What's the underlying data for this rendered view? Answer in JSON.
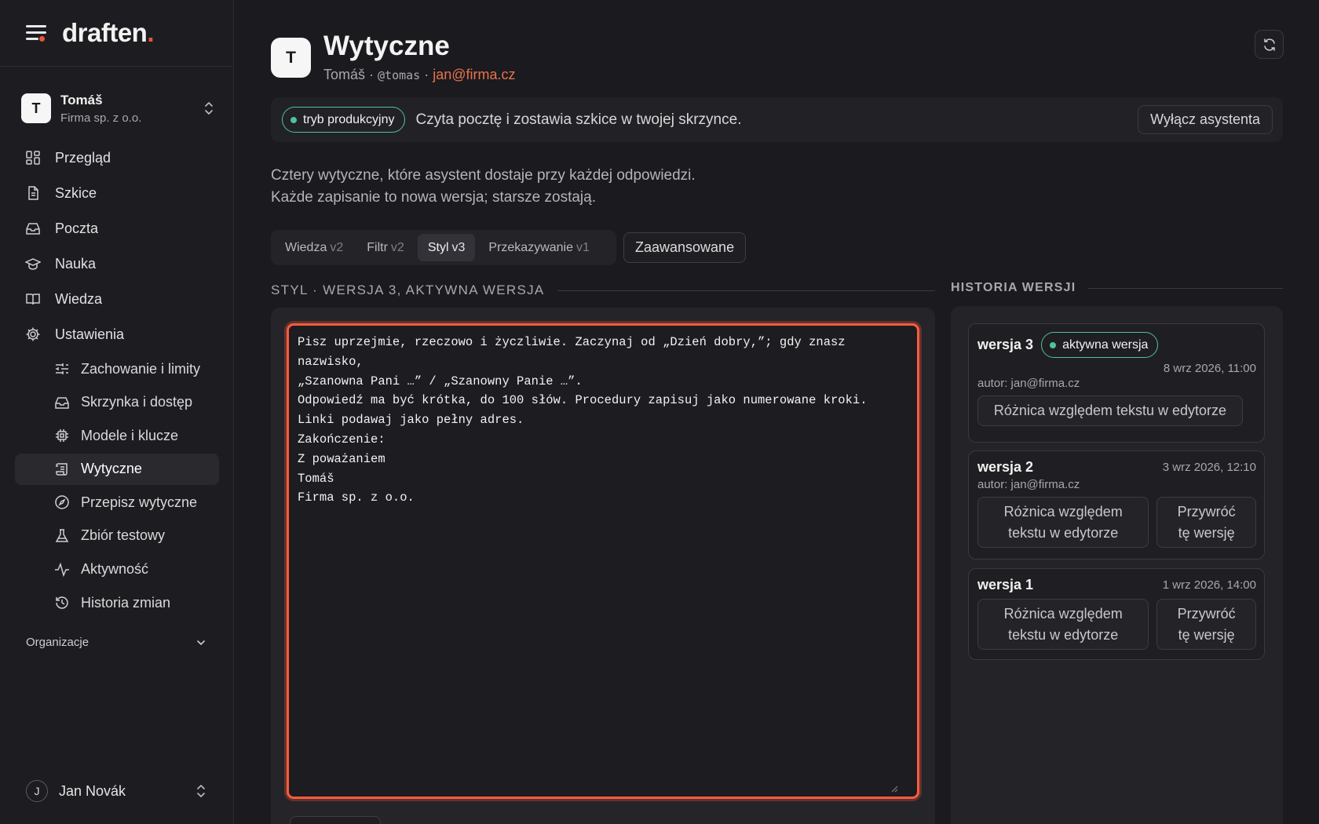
{
  "brand": {
    "name": "draften",
    "dot": "."
  },
  "account": {
    "initial": "T",
    "name": "Tomáš",
    "company": "Firma sp. z o.o."
  },
  "nav": {
    "items": [
      {
        "label": "Przegląd",
        "icon": "grid-icon"
      },
      {
        "label": "Szkice",
        "icon": "document-icon"
      },
      {
        "label": "Poczta",
        "icon": "inbox-icon"
      },
      {
        "label": "Nauka",
        "icon": "graduation-cap-icon"
      },
      {
        "label": "Wiedza",
        "icon": "book-icon"
      },
      {
        "label": "Ustawienia",
        "icon": "gear-icon"
      }
    ],
    "subitems": [
      {
        "label": "Zachowanie i limity",
        "icon": "sliders-icon"
      },
      {
        "label": "Skrzynka i dostęp",
        "icon": "inbox-icon"
      },
      {
        "label": "Modele i klucze",
        "icon": "cpu-icon"
      },
      {
        "label": "Wytyczne",
        "icon": "scroll-icon",
        "active": true
      },
      {
        "label": "Przepisz wytyczne",
        "icon": "compass-icon"
      },
      {
        "label": "Zbiór testowy",
        "icon": "flask-icon"
      },
      {
        "label": "Aktywność",
        "icon": "activity-icon"
      },
      {
        "label": "Historia zmian",
        "icon": "history-icon"
      }
    ],
    "organizations_label": "Organizacje"
  },
  "user": {
    "initial": "J",
    "name": "Jan Novák"
  },
  "header": {
    "initial": "T",
    "title": "Wytyczne",
    "name": "Tomáš",
    "sep": " · ",
    "handle": "@tomas",
    "email": "jan@firma.cz"
  },
  "banner": {
    "pill": "tryb produkcyjny",
    "text": "Czyta pocztę i zostawia szkice w twojej skrzynce.",
    "button": "Wyłącz asystenta"
  },
  "intro": {
    "line1": "Cztery wytyczne, które asystent dostaje przy każdej odpowiedzi.",
    "line2": "Każde zapisanie to nowa wersja; starsze zostają."
  },
  "tabs": [
    {
      "label": "Wiedza",
      "version": "v2"
    },
    {
      "label": "Filtr",
      "version": "v2"
    },
    {
      "label": "Styl",
      "version": "v3",
      "active": true
    },
    {
      "label": "Przekazywanie",
      "version": "v1"
    }
  ],
  "advanced_button": "Zaawansowane",
  "section_title": "STYL · WERSJA 3, AKTYWNA WERSJA",
  "editor_text": "Pisz uprzejmie, rzeczowo i życzliwie. Zaczynaj od „Dzień dobry,”; gdy znasz nazwisko,\n„Szanowna Pani …” / „Szanowny Panie …”.\nOdpowiedź ma być krótka, do 100 słów. Procedury zapisuj jako numerowane kroki.\nLinki podawaj jako pełny adres.\nZakończenie:\nZ poważaniem\nTomáš\nFirma sp. z o.o.",
  "history": {
    "title": "HISTORIA WERSJI",
    "versions": [
      {
        "name": "wersja 3",
        "badge": "aktywna wersja",
        "date": "8 wrz 2026, 11:00",
        "author": "autor: jan@firma.cz",
        "diff_button": "Różnica względem tekstu w edytorze"
      },
      {
        "name": "wersja 2",
        "date": "3 wrz 2026, 12:10",
        "author": "autor: jan@firma.cz",
        "diff_line1": "Różnica względem",
        "diff_line2": "tekstu w edytorze",
        "restore_line1": "Przywróć",
        "restore_line2": "tę wersję"
      },
      {
        "name": "wersja 1",
        "date": "1 wrz 2026, 14:00",
        "diff_line1": "Różnica względem",
        "diff_line2": "tekstu w edytorze",
        "restore_line1": "Przywróć",
        "restore_line2": "tę wersję"
      }
    ]
  },
  "colors": {
    "accent": "#e8553b",
    "success": "#4fc39a",
    "focus": "#ff5b3c"
  }
}
